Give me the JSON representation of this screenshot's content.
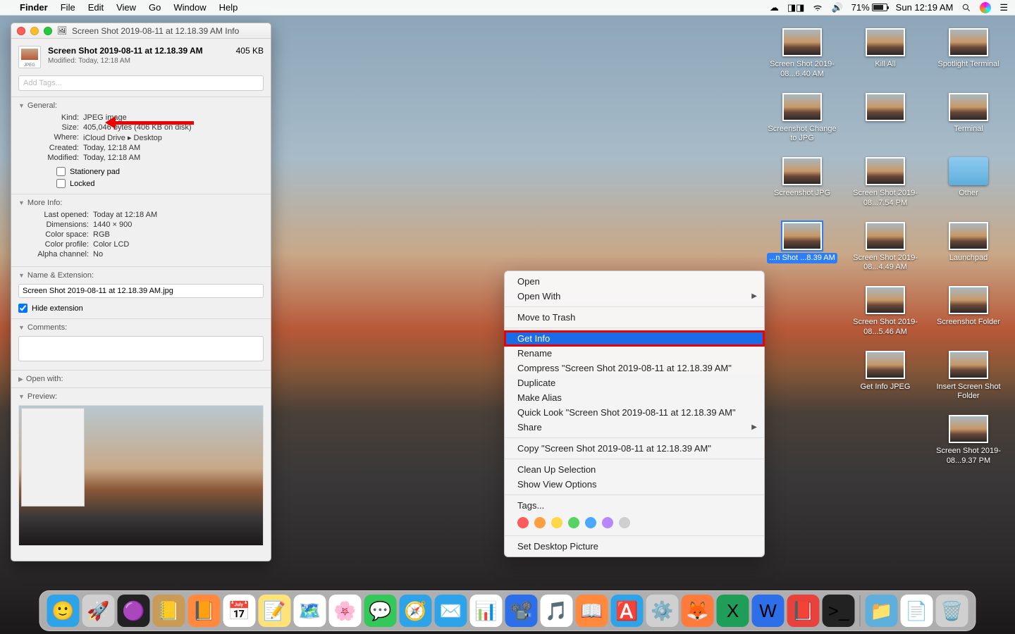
{
  "menubar": {
    "app": "Finder",
    "items": [
      "File",
      "Edit",
      "View",
      "Go",
      "Window",
      "Help"
    ],
    "battery": "71%",
    "clock": "Sun 12:19 AM"
  },
  "info_window": {
    "title": "Screen Shot 2019-08-11 at 12.18.39 AM Info",
    "filename": "Screen Shot 2019-08-11 at 12.18.39 AM",
    "modified_sub": "Modified: Today, 12:18 AM",
    "filesize": "405 KB",
    "tags_placeholder": "Add Tags...",
    "sections": {
      "general": {
        "label": "General:",
        "rows": {
          "kind_k": "Kind:",
          "kind_v": "JPEG image",
          "size_k": "Size:",
          "size_v": "405,046 bytes (406 KB on disk)",
          "where_k": "Where:",
          "where_v": "iCloud Drive ▸ Desktop",
          "created_k": "Created:",
          "created_v": "Today, 12:18 AM",
          "modified_k": "Modified:",
          "modified_v": "Today, 12:18 AM"
        },
        "stationery": "Stationery pad",
        "locked": "Locked"
      },
      "more_info": {
        "label": "More Info:",
        "rows": {
          "lastopen_k": "Last opened:",
          "lastopen_v": "Today at 12:18 AM",
          "dim_k": "Dimensions:",
          "dim_v": "1440 × 900",
          "cs_k": "Color space:",
          "cs_v": "RGB",
          "cp_k": "Color profile:",
          "cp_v": "Color LCD",
          "alpha_k": "Alpha channel:",
          "alpha_v": "No"
        }
      },
      "name_ext": {
        "label": "Name & Extension:",
        "value": "Screen Shot 2019-08-11 at 12.18.39 AM.jpg",
        "hide_ext": "Hide extension"
      },
      "comments": {
        "label": "Comments:"
      },
      "open_with": {
        "label": "Open with:"
      },
      "preview": {
        "label": "Preview:"
      }
    }
  },
  "context_menu": {
    "open": "Open",
    "open_with": "Open With",
    "move_trash": "Move to Trash",
    "get_info": "Get Info",
    "rename": "Rename",
    "compress": "Compress \"Screen Shot 2019-08-11 at 12.18.39 AM\"",
    "duplicate": "Duplicate",
    "make_alias": "Make Alias",
    "quick_look": "Quick Look \"Screen Shot 2019-08-11 at 12.18.39 AM\"",
    "share": "Share",
    "copy": "Copy \"Screen Shot 2019-08-11 at 12.18.39 AM\"",
    "clean_up": "Clean Up Selection",
    "view_options": "Show View Options",
    "tags": "Tags...",
    "set_desktop": "Set Desktop Picture",
    "tag_colors": [
      "#ff5b5b",
      "#ff9f40",
      "#ffd84a",
      "#56d364",
      "#4aa8ff",
      "#b886ff",
      "#cfcfcf"
    ]
  },
  "desktop_icons": [
    {
      "label": "Screen Shot 2019-08...6.40 AM",
      "type": "img"
    },
    {
      "label": "Kill All",
      "type": "img"
    },
    {
      "label": "Spotlight Terminal",
      "type": "img"
    },
    {
      "label": "Screenshot Change to JPG",
      "type": "img"
    },
    {
      "label": "",
      "type": "img"
    },
    {
      "label": "Terminal",
      "type": "img"
    },
    {
      "label": "Screenshot JPG",
      "type": "img"
    },
    {
      "label": "Screen Shot 2019-08...7.54 PM",
      "type": "img"
    },
    {
      "label": "Other",
      "type": "folder"
    },
    {
      "label": "...n Shot ...8.39 AM",
      "type": "img",
      "selected": true
    },
    {
      "label": "Screen Shot 2019-08...4.49 AM",
      "type": "img"
    },
    {
      "label": "Launchpad",
      "type": "img"
    },
    {
      "label": "",
      "type": "spacer"
    },
    {
      "label": "Screen Shot 2019-08...5.46 AM",
      "type": "img"
    },
    {
      "label": "Screenshot Folder",
      "type": "img"
    },
    {
      "label": "",
      "type": "spacer"
    },
    {
      "label": "Get Info JPEG",
      "type": "img"
    },
    {
      "label": "Insert Screen Shot Folder",
      "type": "img"
    },
    {
      "label": "",
      "type": "spacer"
    },
    {
      "label": "",
      "type": "spacer"
    },
    {
      "label": "Screen Shot 2019-08...9.37 PM",
      "type": "img"
    }
  ],
  "dock": [
    {
      "name": "finder",
      "bg": "#2ea3e8",
      "glyph": "🙂"
    },
    {
      "name": "launchpad",
      "bg": "#d0d0d0",
      "glyph": "🚀"
    },
    {
      "name": "siri",
      "bg": "#222",
      "glyph": "🟣"
    },
    {
      "name": "contacts",
      "bg": "#c99b57",
      "glyph": "📒"
    },
    {
      "name": "ibooks",
      "bg": "#ff8a3d",
      "glyph": "📙"
    },
    {
      "name": "calendar",
      "bg": "#fff",
      "glyph": "📅"
    },
    {
      "name": "notes",
      "bg": "#ffe27a",
      "glyph": "📝"
    },
    {
      "name": "maps",
      "bg": "#fff",
      "glyph": "🗺️"
    },
    {
      "name": "photos",
      "bg": "#fff",
      "glyph": "🌸"
    },
    {
      "name": "messages",
      "bg": "#34c759",
      "glyph": "💬"
    },
    {
      "name": "safari",
      "bg": "#2ea3e8",
      "glyph": "🧭"
    },
    {
      "name": "mail",
      "bg": "#2ea3e8",
      "glyph": "✉️"
    },
    {
      "name": "numbers",
      "bg": "#fff",
      "glyph": "📊"
    },
    {
      "name": "keynote",
      "bg": "#2d6fe8",
      "glyph": "📽️"
    },
    {
      "name": "itunes",
      "bg": "#fff",
      "glyph": "🎵"
    },
    {
      "name": "ibooks2",
      "bg": "#ff8a3d",
      "glyph": "📖"
    },
    {
      "name": "appstore",
      "bg": "#2ea3e8",
      "glyph": "🅰️"
    },
    {
      "name": "settings",
      "bg": "#d0d0d0",
      "glyph": "⚙️"
    },
    {
      "name": "firefox",
      "bg": "#ff7b3d",
      "glyph": "🦊"
    },
    {
      "name": "excel",
      "bg": "#1e9e58",
      "glyph": "X"
    },
    {
      "name": "word",
      "bg": "#2d6fe8",
      "glyph": "W"
    },
    {
      "name": "pdf",
      "bg": "#e8423d",
      "glyph": "📕"
    },
    {
      "name": "terminal",
      "bg": "#222",
      "glyph": ">_"
    }
  ],
  "dock_right": [
    {
      "name": "downloads",
      "bg": "#5eafdc",
      "glyph": "📁"
    },
    {
      "name": "docs",
      "bg": "#fff",
      "glyph": "📄"
    },
    {
      "name": "trash",
      "bg": "#d0d0d0",
      "glyph": "🗑️"
    }
  ]
}
